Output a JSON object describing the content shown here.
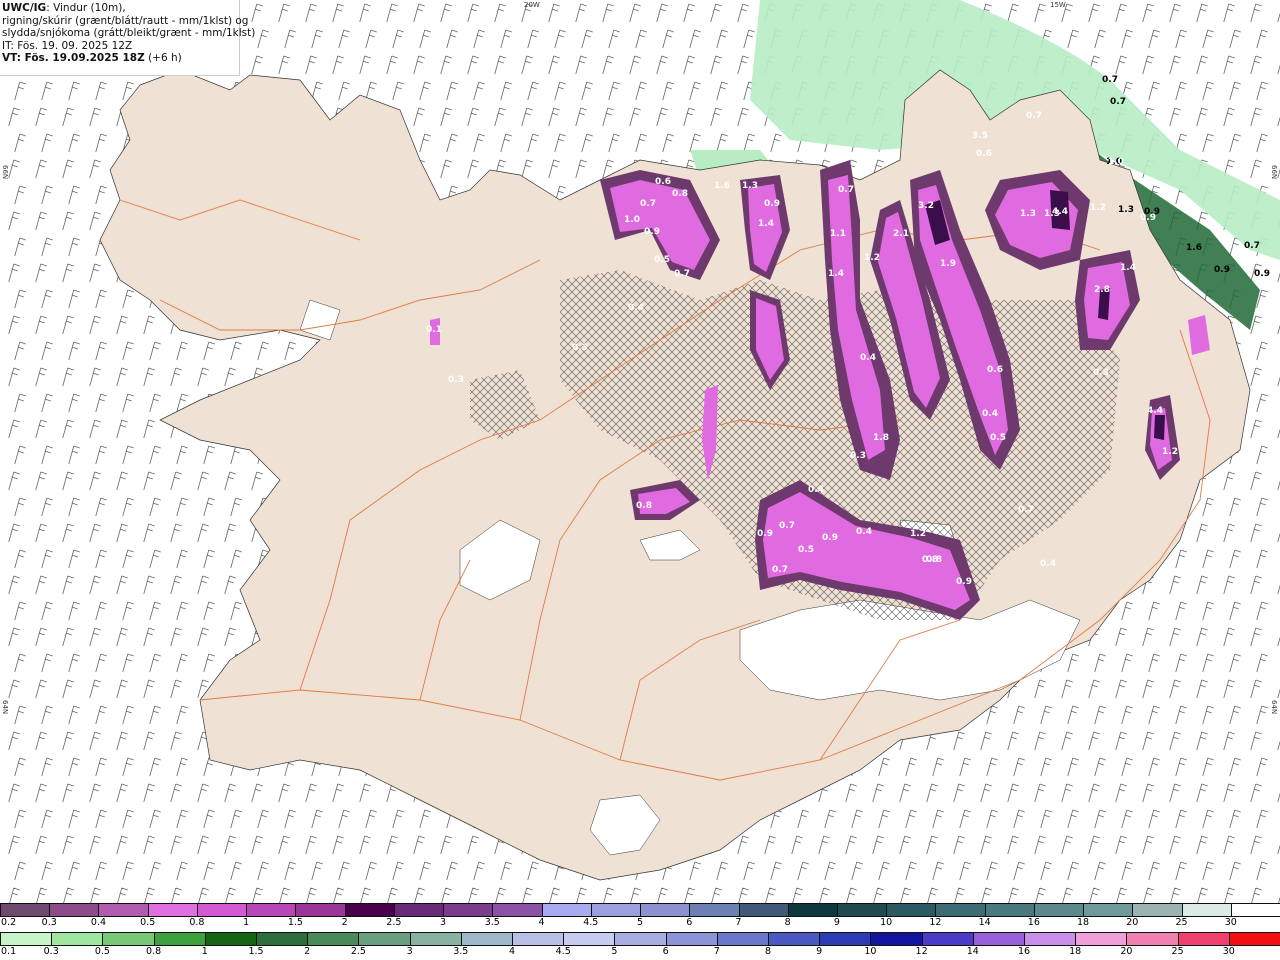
{
  "header": {
    "brand": "UWC/IG",
    "line1_rest": ": Vindur (10m),",
    "line2": "rigning/skúrir (grænt/blátt/rautt - mm/1klst) og",
    "line3": "slydda/snjókoma (grátt/bleikt/grænt - mm/1klst)",
    "line4": "IT: Fös. 19. 09. 2025 12Z",
    "line5_bold": "VT: Fös. 19.09.2025 18Z",
    "line5_rest": " (+6 h)"
  },
  "graticule": {
    "lon_top_left": "20W",
    "lon_top_right": "15W",
    "lat_left_upper": "66N",
    "lat_left_lower": "64N",
    "lat_right_upper": "66N",
    "lat_right_lower": "64N"
  },
  "map_labels": [
    "0.6",
    "0.7",
    "0.8",
    "1.0",
    "0.9",
    "0.5",
    "0.7",
    "1.6",
    "1.3",
    "0.9",
    "1.4",
    "0.7",
    "1.1",
    "1.4",
    "1.2",
    "2.1",
    "3.2",
    "1.9",
    "1.3",
    "4.4",
    "1.2",
    "1.3",
    "0.9",
    "1.0",
    "0.7",
    "0.7",
    "0.7",
    "3.5",
    "0.6",
    "1.4",
    "2.8",
    "0.3",
    "4.4",
    "1.2",
    "0.4",
    "0.4",
    "0.8",
    "1.8",
    "0.3",
    "0.5",
    "0.4",
    "0.6",
    "0.9",
    "0.7",
    "0.9",
    "0.4",
    "0.7",
    "0.5",
    "0.9",
    "1.2",
    "0.8",
    "0.9",
    "0.4",
    "0.7",
    "1.6",
    "0.9",
    "0.7",
    "0.9",
    "1.0",
    "1.3",
    "0.1",
    "0.3",
    "0.3",
    "0.8",
    "0.4"
  ],
  "legend_top": {
    "labels": [
      "0.2",
      "0.3",
      "0.4",
      "0.5",
      "0.8",
      "1",
      "1.5",
      "2",
      "2.5",
      "3",
      "3.5",
      "4",
      "4.5",
      "5",
      "6",
      "7",
      "8",
      "9",
      "10",
      "12",
      "14",
      "16",
      "18",
      "20",
      "25",
      "30"
    ],
    "colors": [
      "#6e4a6e",
      "#8c4c8c",
      "#b05ab0",
      "#e070e0",
      "#d45ad4",
      "#b946b9",
      "#9a369a",
      "#4a004a",
      "#6a2a7a",
      "#7a3c8c",
      "#8c52a8",
      "#aaaaf0",
      "#9aa0e0",
      "#8c92d0",
      "#6c80b4",
      "#3e5a78",
      "#0e3840",
      "#1e4a50",
      "#2c5a62",
      "#3c6c74",
      "#4a7a80",
      "#5c8a8c",
      "#6e9a9a",
      "#9ab4b4",
      "#dcebe6",
      "#ffffff"
    ]
  },
  "legend_bottom": {
    "labels": [
      "0.1",
      "0.3",
      "0.5",
      "0.8",
      "1",
      "1.5",
      "2",
      "2.5",
      "3",
      "3.5",
      "4",
      "4.5",
      "5",
      "6",
      "7",
      "8",
      "9",
      "10",
      "12",
      "14",
      "16",
      "18",
      "20",
      "25",
      "30"
    ],
    "colors": [
      "#c8f5c8",
      "#a0e6a0",
      "#78c878",
      "#3ea03e",
      "#146414",
      "#2e6e3e",
      "#4a8a5a",
      "#6a9e80",
      "#8ab2a0",
      "#a2b8c8",
      "#b8c0e6",
      "#c8ccf0",
      "#a8aee0",
      "#8c94d8",
      "#6a78c8",
      "#4a5ac0",
      "#2c3cb4",
      "#1414a0",
      "#4a3cc8",
      "#9860d8",
      "#c890e8",
      "#f0a0d8",
      "#f080b0",
      "#f04070",
      "#f01010"
    ]
  }
}
